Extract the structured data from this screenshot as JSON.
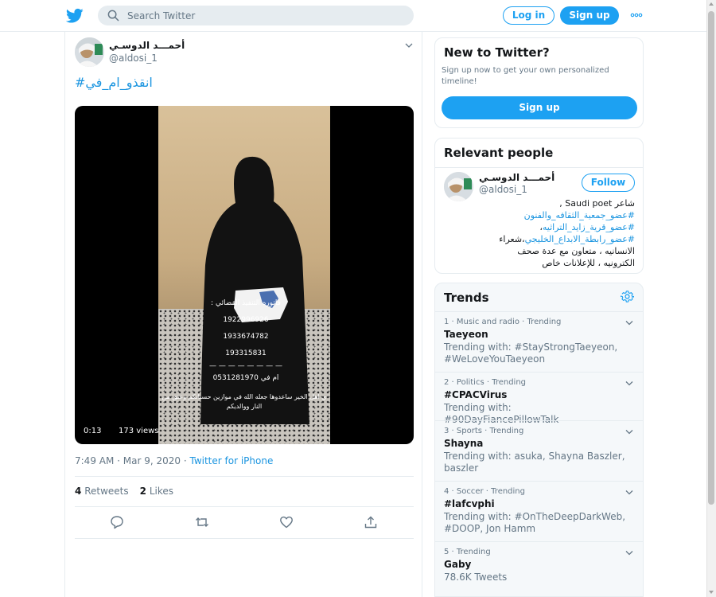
{
  "header": {
    "logo_icon": "twitter-bird-icon",
    "search_placeholder": "Search Twitter",
    "login_label": "Log in",
    "signup_label": "Sign up",
    "more_icon": "more-horizontal-icon",
    "brand_color": "#1da1f2"
  },
  "tweet": {
    "author_name": "أحمـــد الدوسـي",
    "author_handle": "@aldosi_1",
    "text": "#انقذو_ام_في",
    "video": {
      "overlay_lines": [
        ": فاتوره التنفيذ القضائي",
        "1922996926",
        "1933674782",
        "193315831",
        "— — — — — — — —",
        "0531281970 ام في"
      ],
      "caption": "ي اهل الخير ساعدوها جعله الله في موازين حسناتكم وعتق من النار ووالديكم",
      "duration": "0:13",
      "views": "173 views"
    },
    "timestamp": "7:49 AM · Mar 9, 2020 · ",
    "source": "Twitter for iPhone",
    "retweets_count": "4",
    "retweets_label": "Retweets",
    "likes_count": "2",
    "likes_label": "Likes",
    "actions": [
      "reply-icon",
      "retweet-icon",
      "like-icon",
      "share-icon"
    ]
  },
  "new_to_twitter": {
    "title": "New to Twitter?",
    "description": "Sign up now to get your own personalized timeline!",
    "signup_label": "Sign up"
  },
  "relevant_people": {
    "title": "Relevant people",
    "name": "أحمـــد الدوسـي",
    "handle": "@aldosi_1",
    "follow_label": "Follow",
    "bio": {
      "line1": "شاعر Saudi poet ,",
      "line2": "#عضو_جمعية_الثقافه_والفنون",
      "line3_tag": "#عضو_قرية_زايد_التراثيه",
      "line3_rest": "،",
      "line4_tag": "#عضو_رابطة_الابداع_الخليجي",
      "line4_rest": "،شعراء",
      "line5": "الانسانيه ، متعاون مع عدة صحف",
      "line6": "الكترونيه ، للإعلانات خاص"
    }
  },
  "trends": {
    "title": "Trends",
    "settings_icon": "gear-icon",
    "items": [
      {
        "meta": "1 · Music and radio · Trending",
        "name": "Taeyeon",
        "desc": "Trending with: #StayStrongTaeyeon, #WeLoveYouTaeyeon"
      },
      {
        "meta": "2 · Politics · Trending",
        "name": "#CPACVirus",
        "desc": "Trending with: #90DayFiancePillowTalk"
      },
      {
        "meta": "3 · Sports · Trending",
        "name": "Shayna",
        "desc": "Trending with: asuka, Shayna Baszler, baszler"
      },
      {
        "meta": "4 · Soccer · Trending",
        "name": "#lafcvphi",
        "desc": "Trending with: #OnTheDeepDarkWeb, #DOOP, Jon Hamm"
      },
      {
        "meta": "5 · Trending",
        "name": "Gaby",
        "desc": "78.6K Tweets"
      }
    ]
  }
}
